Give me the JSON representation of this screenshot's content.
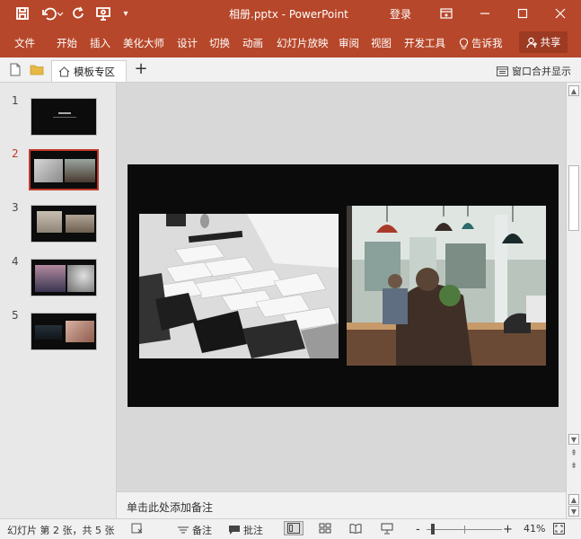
{
  "window": {
    "title": "相册.pptx - PowerPoint",
    "login_label": "登录",
    "accent_color": "#b7472a"
  },
  "quick_access": {
    "icons": [
      "save-icon",
      "undo-icon",
      "redo-icon",
      "present-from-start-icon",
      "customize-icon"
    ]
  },
  "ribbon": {
    "tabs": [
      "文件",
      "开始",
      "插入",
      "美化大师",
      "设计",
      "切换",
      "动画",
      "幻灯片放映",
      "审阅",
      "视图",
      "开发工具"
    ],
    "tell_me": "告诉我",
    "share": "共享"
  },
  "tabbar": {
    "doc_tab": "模板专区",
    "merge_label": "窗口合并显示"
  },
  "slides": {
    "numbers": [
      "1",
      "2",
      "3",
      "4",
      "5"
    ],
    "selected": 2,
    "selected_color": "#c0392b"
  },
  "notes": {
    "placeholder": "单击此处添加备注"
  },
  "status": {
    "slide_info": "幻灯片 第 2 张，共 5 张",
    "notes_label": "备注",
    "comments_label": "批注",
    "zoom_minus": "-",
    "zoom_plus": "+",
    "zoom_value": "41%"
  }
}
